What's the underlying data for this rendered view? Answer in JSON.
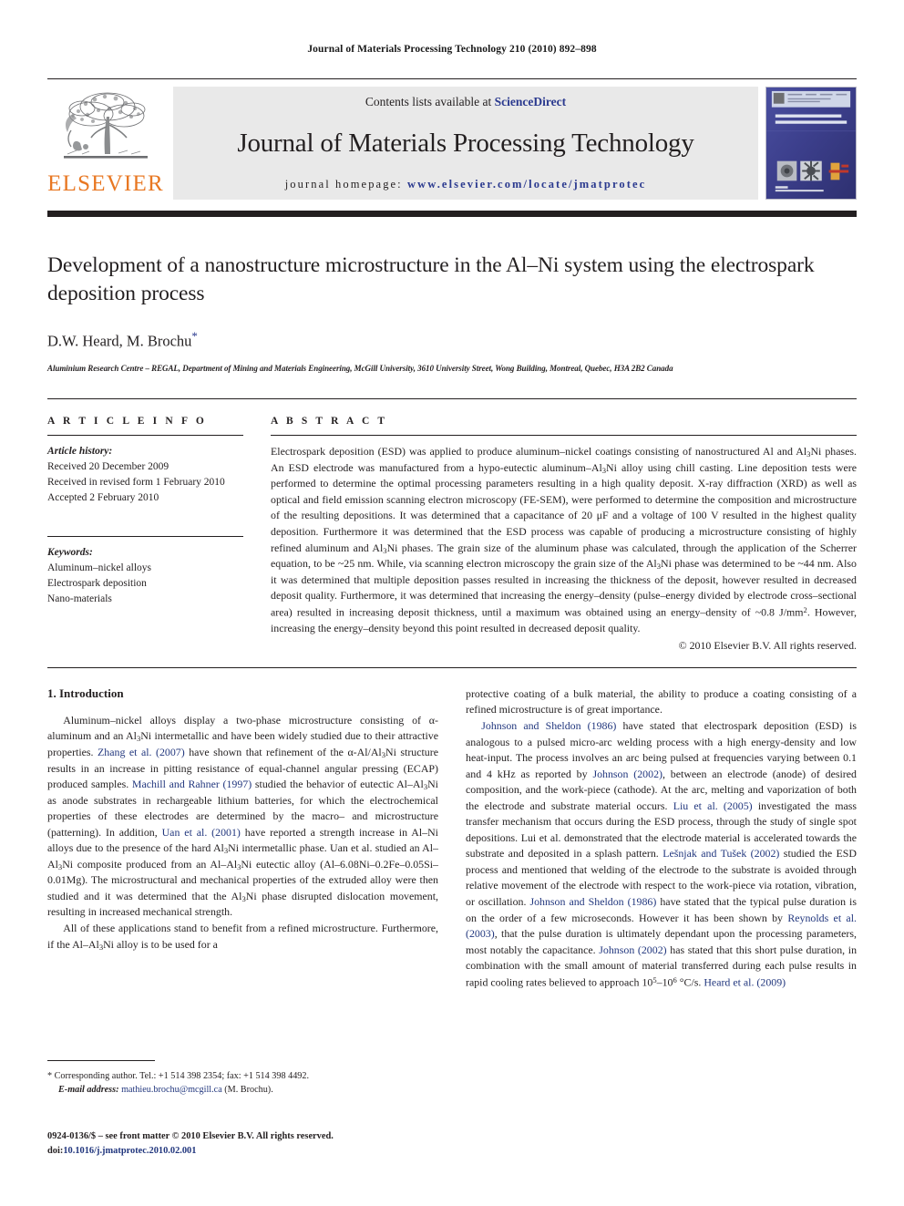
{
  "running_head": "Journal of Materials Processing Technology 210 (2010) 892–898",
  "masthead": {
    "contents_prefix": "Contents lists available at",
    "sciencedirect": "ScienceDirect",
    "journal_title": "Journal of Materials Processing Technology",
    "homepage_label": "journal homepage:",
    "homepage_url": "www.elsevier.com/locate/jmatprotec",
    "publisher_wordmark": "ELSEVIER",
    "cover_title_line1": "JOURNAL OF MATERIALS",
    "cover_title_line2": "PROCESSING TECHNOLOGY",
    "accent_orange": "#E87722",
    "link_blue": "#2b3a8f"
  },
  "article": {
    "title": "Development of a nanostructure microstructure in the Al–Ni system using the electrospark deposition process",
    "authors": "D.W. Heard, M. Brochu",
    "corresponding_marker": "*",
    "affiliation": "Aluminium Research Centre – REGAL, Department of Mining and Materials Engineering, McGill University, 3610 University Street, Wong Building, Montreal, Quebec, H3A 2B2 Canada"
  },
  "article_info": {
    "label": "A R T I C L E    I N F O",
    "history_head": "Article history:",
    "history": [
      "Received 20 December 2009",
      "Received in revised form 1 February 2010",
      "Accepted 2 February 2010"
    ],
    "keywords_head": "Keywords:",
    "keywords": [
      "Aluminum–nickel alloys",
      "Electrospark deposition",
      "Nano-materials"
    ]
  },
  "abstract": {
    "label": "A B S T R A C T",
    "body_html": "Electrospark deposition (ESD) was applied to produce aluminum–nickel coatings consisting of nanostructured Al and Al<sub>3</sub>Ni phases. An ESD electrode was manufactured from a hypo-eutectic aluminum–Al<sub>3</sub>Ni alloy using chill casting. Line deposition tests were performed to determine the optimal processing parameters resulting in a high quality deposit. X-ray diffraction (XRD) as well as optical and field emission scanning electron microscopy (FE-SEM), were performed to determine the composition and microstructure of the resulting depositions. It was determined that a capacitance of 20 μF and a voltage of 100 V resulted in the highest quality deposition. Furthermore it was determined that the ESD process was capable of producing a microstructure consisting of highly refined aluminum and Al<sub>3</sub>Ni phases. The grain size of the aluminum phase was calculated, through the application of the Scherrer equation, to be ~25 nm. While, via scanning electron microscopy the grain size of the Al<sub>3</sub>Ni phase was determined to be ~44 nm. Also it was determined that multiple deposition passes resulted in increasing the thickness of the deposit, however resulted in decreased deposit quality. Furthermore, it was determined that increasing the energy–density (pulse–energy divided by electrode cross–sectional area) resulted in increasing deposit thickness, until a maximum was obtained using an energy–density of ~0.8 J/mm<sup>2</sup>. However, increasing the energy–density beyond this point resulted in decreased deposit quality.",
    "copyright": "© 2010 Elsevier B.V. All rights reserved."
  },
  "introduction": {
    "heading": "1.  Introduction",
    "left_paragraphs_html": [
      "Aluminum–nickel alloys display a two-phase microstructure consisting of α-aluminum and an Al<sub>3</sub>Ni intermetallic and have been widely studied due to their attractive properties. <span class=\"cite\">Zhang et al. (2007)</span> have shown that refinement of the α-Al/Al<sub>3</sub>Ni structure results in an increase in pitting resistance of equal-channel angular pressing (ECAP) produced samples. <span class=\"cite\">Machill and Rahner (1997)</span> studied the behavior of eutectic Al–Al<sub>3</sub>Ni as anode substrates in rechargeable lithium batteries, for which the electrochemical properties of these electrodes are determined by the macro– and microstructure (patterning). In addition, <span class=\"cite\">Uan et al. (2001)</span> have reported a strength increase in Al–Ni alloys due to the presence of the hard Al<sub>3</sub>Ni intermetallic phase. Uan et al. studied an Al–Al<sub>3</sub>Ni composite produced from an Al–Al<sub>3</sub>Ni eutectic alloy (Al–6.08Ni–0.2Fe–0.05Si–0.01Mg). The microstructural and mechanical properties of the extruded alloy were then studied and it was determined that the Al<sub>3</sub>Ni phase disrupted dislocation movement, resulting in increased mechanical strength.",
      "All of these applications stand to benefit from a refined microstructure. Furthermore, if the Al–Al<sub>3</sub>Ni alloy is to be used for a"
    ],
    "right_paragraphs_html": [
      "protective coating of a bulk material, the ability to produce a coating consisting of a refined microstructure is of great importance.",
      "<span class=\"cite\">Johnson and Sheldon (1986)</span> have stated that electrospark deposition (ESD) is analogous to a pulsed micro-arc welding process with a high energy-density and low heat-input. The process involves an arc being pulsed at frequencies varying between 0.1 and 4 kHz as reported by <span class=\"cite\">Johnson (2002)</span>, between an electrode (anode) of desired composition, and the work-piece (cathode). At the arc, melting and vaporization of both the electrode and substrate material occurs. <span class=\"cite\">Liu et al. (2005)</span> investigated the mass transfer mechanism that occurs during the ESD process, through the study of single spot depositions. Lui et al. demonstrated that the electrode material is accelerated towards the substrate and deposited in a splash pattern. <span class=\"cite\">Lešnjak and Tušek (2002)</span> studied the ESD process and mentioned that welding of the electrode to the substrate is avoided through relative movement of the electrode with respect to the work-piece via rotation, vibration, or oscillation. <span class=\"cite\">Johnson and Sheldon (1986)</span> have stated that the typical pulse duration is on the order of a few microseconds. However it has been shown by <span class=\"cite\">Reynolds et al. (2003)</span>, that the pulse duration is ultimately dependant upon the processing parameters, most notably the capacitance. <span class=\"cite\">Johnson (2002)</span> has stated that this short pulse duration, in combination with the small amount of material transferred during each pulse results in rapid cooling rates believed to approach 10<sup>5</sup>–10<sup>6</sup> °C/s. <span class=\"cite\">Heard et al. (2009)</span>"
    ]
  },
  "footnote": {
    "line1": "* Corresponding author. Tel.: +1 514 398 2354; fax: +1 514 398 4492.",
    "email_label": "E-mail address:",
    "email": "mathieu.brochu@mcgill.ca",
    "email_suffix": "(M. Brochu)."
  },
  "front_matter": {
    "issn_line": "0924-0136/$ – see front matter © 2010 Elsevier B.V. All rights reserved.",
    "doi_label": "doi:",
    "doi_value": "10.1016/j.jmatprotec.2010.02.001"
  }
}
